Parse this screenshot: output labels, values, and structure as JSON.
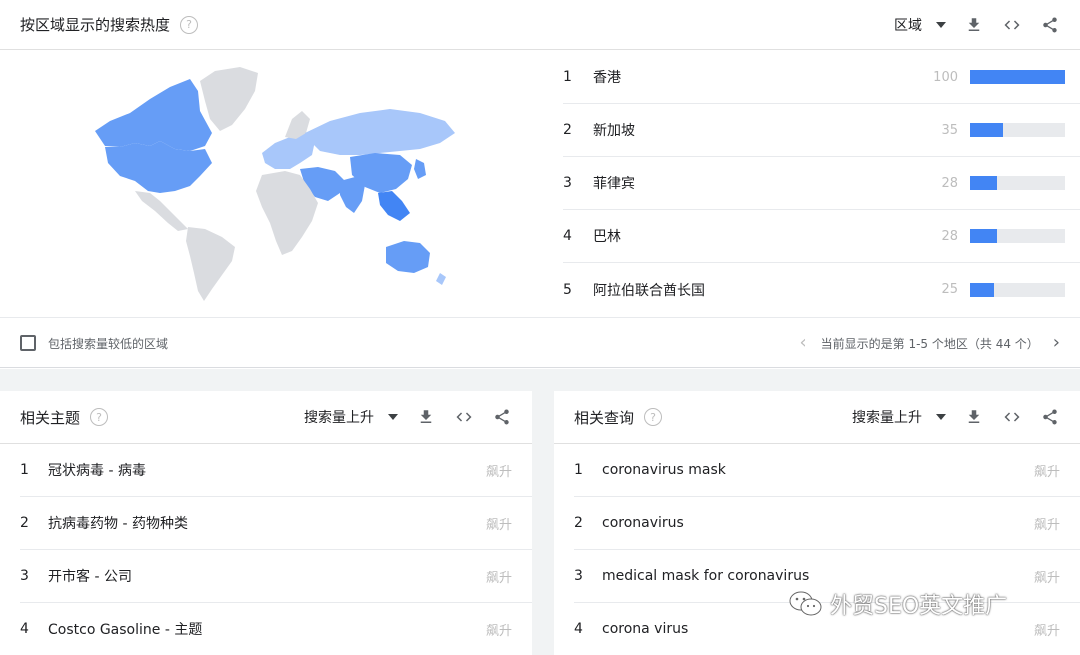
{
  "region_card": {
    "title": "按区域显示的搜索热度",
    "help": "?",
    "dropdown_label": "区域",
    "regions": [
      {
        "rank": "1",
        "name": "香港",
        "value": "100",
        "fraction": 1.0
      },
      {
        "rank": "2",
        "name": "新加坡",
        "value": "35",
        "fraction": 0.35
      },
      {
        "rank": "3",
        "name": "菲律宾",
        "value": "28",
        "fraction": 0.28
      },
      {
        "rank": "4",
        "name": "巴林",
        "value": "28",
        "fraction": 0.28
      },
      {
        "rank": "5",
        "name": "阿拉伯联合酋长国",
        "value": "25",
        "fraction": 0.25
      }
    ],
    "checkbox_label": "包括搜索量较低的区域",
    "pager_text": "当前显示的是第 1-5 个地区（共 44 个）",
    "map_colors": {
      "land": "#dadce0",
      "light": "#a8c7fa",
      "medium": "#669df6",
      "strong": "#4285f4"
    }
  },
  "topics_card": {
    "title": "相关主题",
    "help": "?",
    "dropdown_label": "搜索量上升",
    "items": [
      {
        "rank": "1",
        "text": "冠状病毒 - 病毒",
        "value": "飙升"
      },
      {
        "rank": "2",
        "text": "抗病毒药物 - 药物种类",
        "value": "飙升"
      },
      {
        "rank": "3",
        "text": "开市客 - 公司",
        "value": "飙升"
      },
      {
        "rank": "4",
        "text": "Costco Gasoline - 主题",
        "value": "飙升"
      }
    ]
  },
  "queries_card": {
    "title": "相关查询",
    "help": "?",
    "dropdown_label": "搜索量上升",
    "items": [
      {
        "rank": "1",
        "text": "coronavirus mask",
        "value": "飙升"
      },
      {
        "rank": "2",
        "text": "coronavirus",
        "value": "飙升"
      },
      {
        "rank": "3",
        "text": "medical mask for coronavirus",
        "value": "飙升"
      },
      {
        "rank": "4",
        "text": "corona virus",
        "value": "飙升"
      }
    ]
  },
  "watermark": "外贸SEO英文推广",
  "icons": [
    "help-icon",
    "caret-down-icon",
    "download-icon",
    "embed-icon",
    "share-icon",
    "chevron-left-icon",
    "chevron-right-icon",
    "wechat-icon"
  ]
}
